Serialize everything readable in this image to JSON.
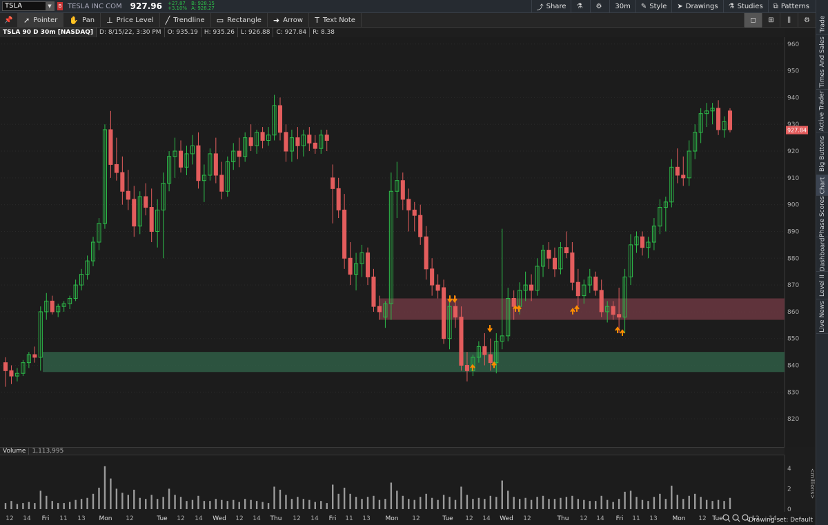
{
  "header": {
    "symbol": "TSLA",
    "company": "TESLA INC COM",
    "last": "927.96",
    "change": "+27.87",
    "change_pct": "+3.10%",
    "bid": "B: 928.15",
    "ask": "A: 928.27",
    "buttons": [
      {
        "label": "Share",
        "icon": "share-icon"
      },
      {
        "label": "",
        "icon": "flask-icon"
      },
      {
        "label": "",
        "icon": "gear-icon"
      },
      {
        "label": "30m",
        "icon": ""
      },
      {
        "label": "Style",
        "icon": "style-icon"
      },
      {
        "label": "Drawings",
        "icon": "cursor-icon"
      },
      {
        "label": "Studies",
        "icon": "flask-icon"
      },
      {
        "label": "Patterns",
        "icon": "patterns-icon"
      }
    ]
  },
  "toolbar": {
    "tools": [
      {
        "label": "Pointer",
        "icon": "pointer-icon",
        "active": true
      },
      {
        "label": "Pan",
        "icon": "hand-icon"
      },
      {
        "label": "Price Level",
        "icon": "price-level-icon"
      },
      {
        "label": "Trendline",
        "icon": "trendline-icon"
      },
      {
        "label": "Rectangle",
        "icon": "rectangle-icon"
      },
      {
        "label": "Arrow",
        "icon": "arrow-icon"
      },
      {
        "label": "Text Note",
        "icon": "text-icon"
      }
    ]
  },
  "info": {
    "title": "TSLA 90 D 30m [NASDAQ]",
    "date": "D: 8/15/22, 3:30 PM",
    "open": "O: 935.19",
    "high": "H: 935.26",
    "low": "L: 926.88",
    "close": "C: 927.84",
    "range": "R: 8.38"
  },
  "sidebar": {
    "tabs": [
      "Trade",
      "Times And Sales",
      "Active Trader",
      "Big Buttons",
      "Chart",
      "Phase Scores",
      "Dashboard",
      "Level II",
      "Live News"
    ],
    "active": "Chart"
  },
  "volume": {
    "label": "Volume",
    "value": "1,113,995",
    "axis_ticks": [
      "4",
      "2",
      "0"
    ],
    "axis_unit": "<millions>"
  },
  "xaxis_labels": [
    "12",
    "14",
    "Fri",
    "11",
    "13",
    "Mon",
    "12",
    "Tue",
    "12",
    "14",
    "Wed",
    "12",
    "14",
    "Thu",
    "12",
    "14",
    "Fri",
    "11",
    "13",
    "Mon",
    "12",
    "Tue",
    "12",
    "14",
    "Wed",
    "12",
    "Thu",
    "12",
    "14",
    "Fri",
    "11",
    "13",
    "Mon",
    "12",
    "Tue",
    "12",
    "14"
  ],
  "status": {
    "drawing_set": "Drawing set: Default"
  },
  "colors": {
    "up": "#2dbd4a",
    "down": "#e35d5d",
    "arrow": "#ff8c00",
    "zone_green": "#2f5d45",
    "zone_red": "#6b3741"
  },
  "chart_data": {
    "type": "candlestick",
    "title": "TSLA 90 D 30m [NASDAQ]",
    "ylim": [
      810,
      962
    ],
    "y_ticks": [
      960,
      950,
      940,
      930,
      920,
      910,
      900,
      890,
      880,
      870,
      860,
      850,
      840,
      830,
      820
    ],
    "last_price_label": "927.84",
    "zones": [
      {
        "name": "support",
        "from": 837.5,
        "to": 845,
        "color": "green"
      },
      {
        "name": "resistance",
        "from": 857,
        "to": 865,
        "color": "red"
      }
    ],
    "candles": [
      [
        841,
        843,
        832,
        838
      ],
      [
        838,
        840,
        833,
        836
      ],
      [
        836,
        839,
        834,
        837
      ],
      [
        837,
        842,
        836,
        841
      ],
      [
        841,
        845,
        839,
        844
      ],
      [
        844,
        847,
        841,
        843
      ],
      [
        843,
        862,
        838,
        860
      ],
      [
        860,
        867,
        857,
        864
      ],
      [
        864,
        866,
        859,
        860
      ],
      [
        860,
        863,
        858,
        862
      ],
      [
        862,
        864,
        860,
        863
      ],
      [
        863,
        866,
        861,
        865
      ],
      [
        865,
        872,
        864,
        870
      ],
      [
        870,
        876,
        868,
        874
      ],
      [
        874,
        881,
        872,
        879
      ],
      [
        879,
        888,
        877,
        886
      ],
      [
        886,
        895,
        883,
        893
      ],
      [
        893,
        930,
        891,
        928
      ],
      [
        928,
        935,
        910,
        915
      ],
      [
        915,
        925,
        909,
        912
      ],
      [
        912,
        918,
        900,
        905
      ],
      [
        905,
        913,
        898,
        902
      ],
      [
        902,
        907,
        888,
        892
      ],
      [
        892,
        905,
        889,
        903
      ],
      [
        903,
        908,
        896,
        899
      ],
      [
        899,
        906,
        886,
        890
      ],
      [
        890,
        902,
        884,
        898
      ],
      [
        898,
        912,
        880,
        908
      ],
      [
        908,
        920,
        905,
        918
      ],
      [
        918,
        925,
        910,
        920
      ],
      [
        920,
        924,
        912,
        914
      ],
      [
        914,
        922,
        911,
        919
      ],
      [
        919,
        926,
        915,
        922
      ],
      [
        922,
        927,
        906,
        909
      ],
      [
        909,
        915,
        901,
        911
      ],
      [
        911,
        921,
        909,
        919
      ],
      [
        919,
        925,
        908,
        911
      ],
      [
        911,
        916,
        902,
        905
      ],
      [
        905,
        918,
        903,
        916
      ],
      [
        916,
        923,
        913,
        920
      ],
      [
        920,
        925,
        914,
        918
      ],
      [
        918,
        927,
        916,
        925
      ],
      [
        925,
        930,
        920,
        922
      ],
      [
        922,
        928,
        919,
        927
      ],
      [
        927,
        929,
        921,
        924
      ],
      [
        924,
        929,
        922,
        926
      ],
      [
        926,
        941,
        924,
        937
      ],
      [
        937,
        940,
        924,
        927
      ],
      [
        927,
        930,
        916,
        920
      ],
      [
        920,
        928,
        916,
        925
      ],
      [
        925,
        929,
        917,
        922
      ],
      [
        922,
        928,
        918,
        926
      ],
      [
        926,
        929,
        920,
        923
      ],
      [
        923,
        926,
        919,
        921
      ],
      [
        921,
        928,
        919,
        926
      ],
      [
        926,
        928,
        920,
        924
      ],
      [
        910,
        915,
        893,
        906
      ],
      [
        906,
        910,
        895,
        898
      ],
      [
        898,
        904,
        876,
        880
      ],
      [
        880,
        886,
        870,
        874
      ],
      [
        874,
        882,
        868,
        878
      ],
      [
        878,
        885,
        873,
        882
      ],
      [
        882,
        884,
        870,
        873
      ],
      [
        873,
        876,
        860,
        862
      ],
      [
        862,
        866,
        857,
        860
      ],
      [
        858,
        864,
        854,
        863
      ],
      [
        863,
        912,
        857,
        905
      ],
      [
        905,
        916,
        895,
        909
      ],
      [
        909,
        912,
        898,
        902
      ],
      [
        902,
        906,
        890,
        898
      ],
      [
        898,
        901,
        890,
        896
      ],
      [
        896,
        900,
        885,
        888
      ],
      [
        888,
        892,
        872,
        876
      ],
      [
        876,
        880,
        866,
        870
      ],
      [
        870,
        874,
        865,
        868
      ],
      [
        869,
        872,
        848,
        850
      ],
      [
        850,
        866,
        846,
        862
      ],
      [
        862,
        866,
        854,
        858
      ],
      [
        858,
        862,
        838,
        840
      ],
      [
        840,
        845,
        834,
        838
      ],
      [
        838,
        844,
        836,
        843
      ],
      [
        843,
        849,
        841,
        847
      ],
      [
        847,
        852,
        840,
        844
      ],
      [
        844,
        850,
        838,
        841
      ],
      [
        841,
        852,
        837,
        849
      ],
      [
        849,
        891,
        846,
        851
      ],
      [
        851,
        869,
        849,
        865
      ],
      [
        865,
        868,
        857,
        862
      ],
      [
        862,
        871,
        859,
        868
      ],
      [
        868,
        875,
        864,
        870
      ],
      [
        870,
        874,
        864,
        868
      ],
      [
        868,
        880,
        866,
        877
      ],
      [
        877,
        885,
        873,
        883
      ],
      [
        883,
        886,
        876,
        880
      ],
      [
        880,
        884,
        873,
        876
      ],
      [
        876,
        886,
        874,
        884
      ],
      [
        884,
        890,
        880,
        882
      ],
      [
        882,
        886,
        868,
        871
      ],
      [
        871,
        876,
        862,
        866
      ],
      [
        866,
        872,
        863,
        870
      ],
      [
        870,
        876,
        867,
        873
      ],
      [
        873,
        875,
        866,
        868
      ],
      [
        868,
        872,
        858,
        860
      ],
      [
        860,
        864,
        856,
        862
      ],
      [
        862,
        864,
        857,
        859
      ],
      [
        859,
        869,
        852,
        858
      ],
      [
        858,
        876,
        852,
        873
      ],
      [
        873,
        889,
        870,
        885
      ],
      [
        885,
        890,
        882,
        888
      ],
      [
        888,
        890,
        881,
        884
      ],
      [
        884,
        888,
        880,
        886
      ],
      [
        886,
        895,
        883,
        892
      ],
      [
        892,
        902,
        889,
        899
      ],
      [
        899,
        903,
        890,
        901
      ],
      [
        901,
        917,
        899,
        914
      ],
      [
        914,
        921,
        908,
        911
      ],
      [
        911,
        918,
        907,
        910
      ],
      [
        910,
        924,
        907,
        920
      ],
      [
        920,
        930,
        917,
        927
      ],
      [
        927,
        936,
        923,
        934
      ],
      [
        934,
        938,
        929,
        935
      ],
      [
        935,
        938,
        930,
        936
      ],
      [
        936,
        939,
        926,
        928
      ],
      [
        928,
        933,
        925,
        931
      ],
      [
        935,
        936,
        927,
        928
      ]
    ],
    "volume_millions": [
      0.6,
      0.8,
      0.5,
      0.6,
      0.7,
      0.6,
      1.8,
      1.3,
      0.8,
      0.6,
      0.6,
      0.7,
      0.9,
      1.0,
      1.1,
      1.5,
      2.1,
      4.2,
      3.0,
      2.0,
      1.6,
      1.4,
      1.9,
      1.1,
      1.0,
      1.4,
      1.0,
      1.2,
      2.0,
      1.4,
      1.2,
      0.8,
      0.9,
      1.3,
      0.8,
      0.8,
      1.0,
      0.9,
      0.8,
      0.9,
      0.7,
      1.0,
      0.9,
      0.8,
      0.7,
      0.6,
      2.2,
      1.9,
      1.4,
      1.0,
      1.2,
      1.0,
      0.9,
      0.7,
      0.8,
      0.6,
      2.4,
      1.5,
      2.1,
      1.5,
      1.2,
      1.0,
      1.2,
      1.3,
      0.9,
      1.0,
      2.6,
      1.8,
      1.3,
      1.0,
      0.9,
      1.2,
      1.5,
      1.1,
      0.9,
      1.4,
      1.2,
      0.9,
      2.2,
      1.4,
      1.0,
      1.1,
      1.0,
      1.3,
      1.2,
      2.8,
      1.8,
      1.2,
      1.0,
      1.1,
      0.9,
      1.2,
      1.3,
      1.0,
      1.0,
      1.1,
      1.2,
      1.3,
      1.0,
      0.9,
      0.8,
      0.8,
      1.3,
      0.9,
      0.7,
      1.0,
      1.7,
      1.8,
      1.2,
      0.9,
      0.8,
      1.2,
      1.5,
      1.0,
      2.3,
      1.4,
      1.0,
      1.3,
      1.5,
      1.2,
      0.9,
      0.8,
      0.9,
      0.8,
      1.1
    ]
  }
}
